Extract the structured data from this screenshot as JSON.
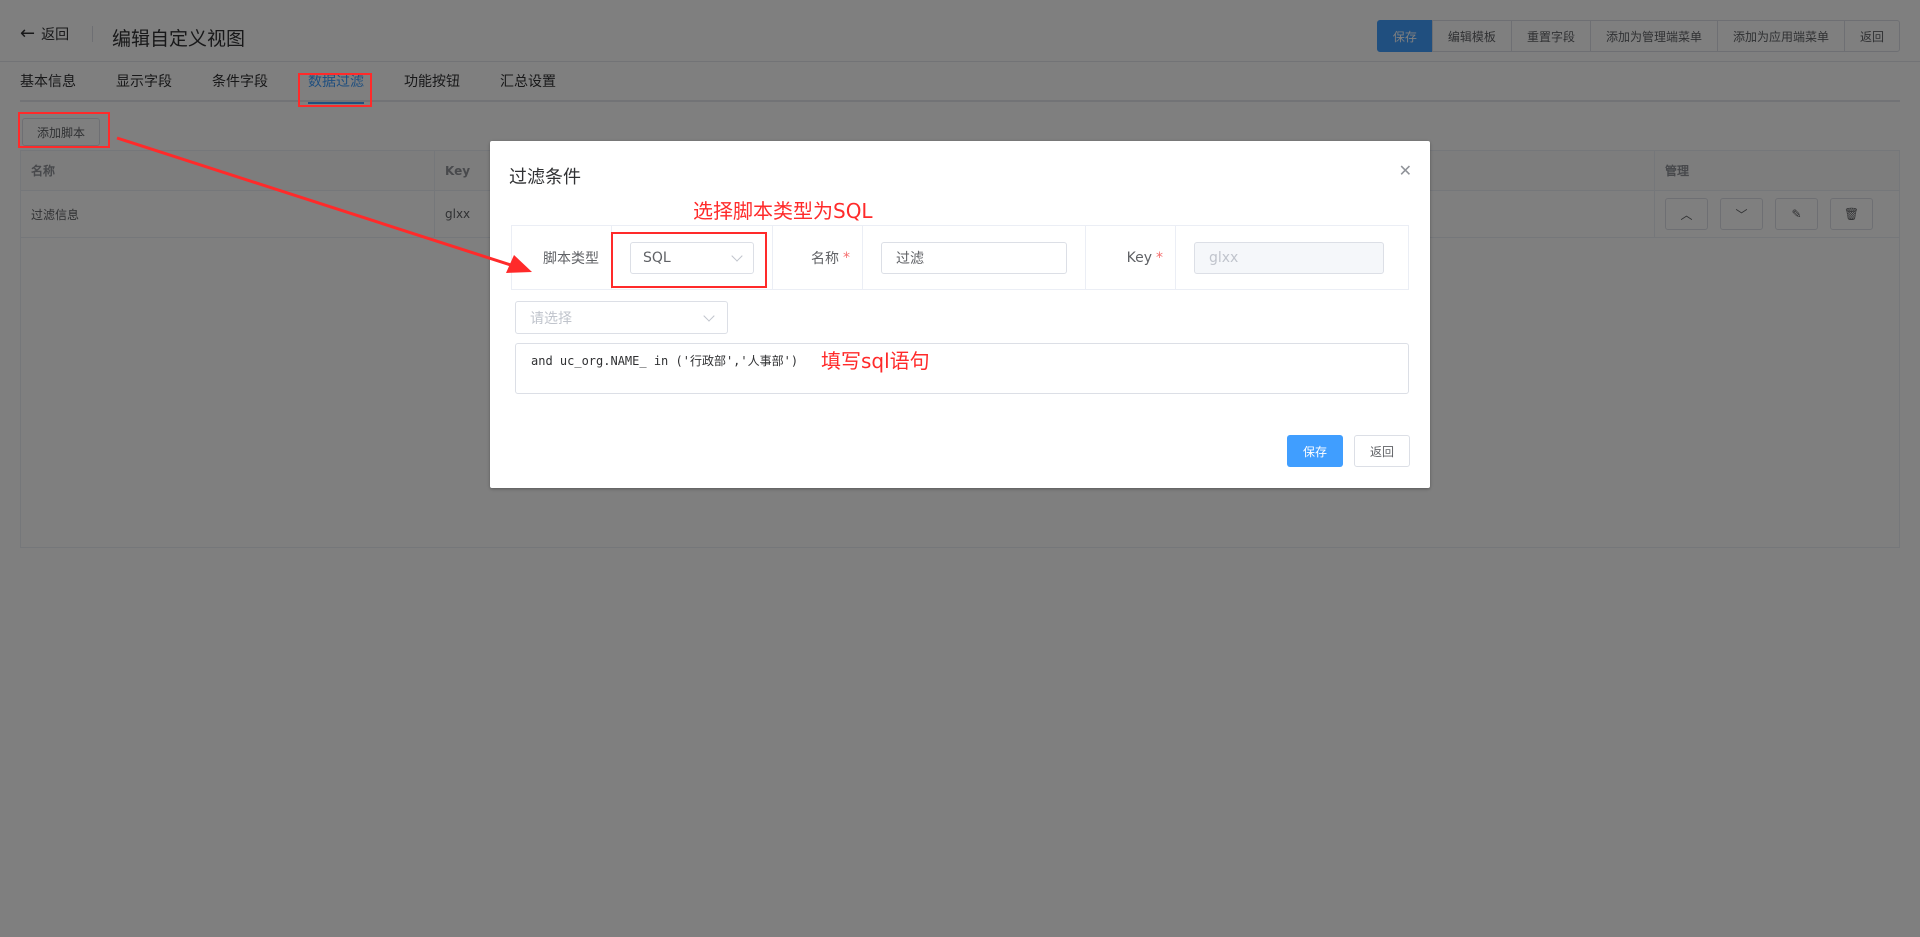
{
  "header": {
    "back_label": "返回",
    "title": "编辑自定义视图",
    "actions": [
      "保存",
      "编辑模板",
      "重置字段",
      "添加为管理端菜单",
      "添加为应用端菜单",
      "返回"
    ]
  },
  "tabs": [
    "基本信息",
    "显示字段",
    "条件字段",
    "数据过滤",
    "功能按钮",
    "汇总设置"
  ],
  "active_tab": "数据过滤",
  "add_script_label": "添加脚本",
  "table": {
    "columns": [
      "名称",
      "Key",
      "管理"
    ],
    "rows": [
      {
        "name": "过滤信息",
        "key": "glxx"
      }
    ]
  },
  "dialog": {
    "title": "过滤条件",
    "script_type_label": "脚本类型",
    "script_type_value": "SQL",
    "name_label": "名称",
    "name_value": "过滤",
    "key_label": "Key",
    "key_value": "glxx",
    "sub_select_placeholder": "请选择",
    "sql_value": "and uc_org.NAME_ in ('行政部','人事部')",
    "save_label": "保存",
    "back_label": "返回"
  },
  "annotations": {
    "select_sql": "选择脚本类型为SQL",
    "fill_sql": "填写sql语句",
    "color": "#ff2a2a"
  },
  "colors": {
    "primary": "#409eff",
    "overlay": "rgba(0,0,0,0.5)"
  }
}
